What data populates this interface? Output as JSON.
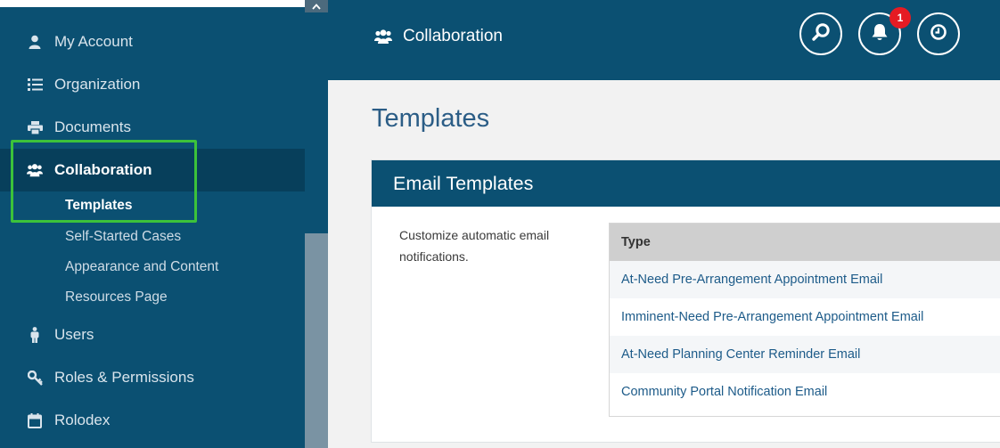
{
  "sidebar": {
    "items": [
      {
        "label": "My Account",
        "icon": "user-icon"
      },
      {
        "label": "Organization",
        "icon": "list-icon"
      },
      {
        "label": "Documents",
        "icon": "printer-icon"
      },
      {
        "label": "Collaboration",
        "icon": "users-icon"
      },
      {
        "label": "Users",
        "icon": "person-icon"
      },
      {
        "label": "Roles & Permissions",
        "icon": "key-icon"
      },
      {
        "label": "Rolodex",
        "icon": "calendar-icon"
      }
    ],
    "subitems": [
      {
        "label": "Templates"
      },
      {
        "label": "Self-Started Cases"
      },
      {
        "label": "Appearance and Content"
      },
      {
        "label": "Resources Page"
      }
    ]
  },
  "header": {
    "title": "Collaboration",
    "notification_count": "1"
  },
  "main": {
    "page_title": "Templates",
    "card_title": "Email Templates",
    "description": "Customize automatic email notifications.",
    "table": {
      "column": "Type",
      "rows": [
        "At-Need Pre-Arrangement Appointment Email",
        "Imminent-Need Pre-Arrangement Appointment Email",
        "At-Need Planning Center Reminder Email",
        "Community Portal Notification Email"
      ]
    }
  },
  "colors": {
    "primary": "#0b5072",
    "active": "#073f5b",
    "highlight": "#3cc23a",
    "link": "#1d5b89",
    "badge": "#e51b23"
  }
}
